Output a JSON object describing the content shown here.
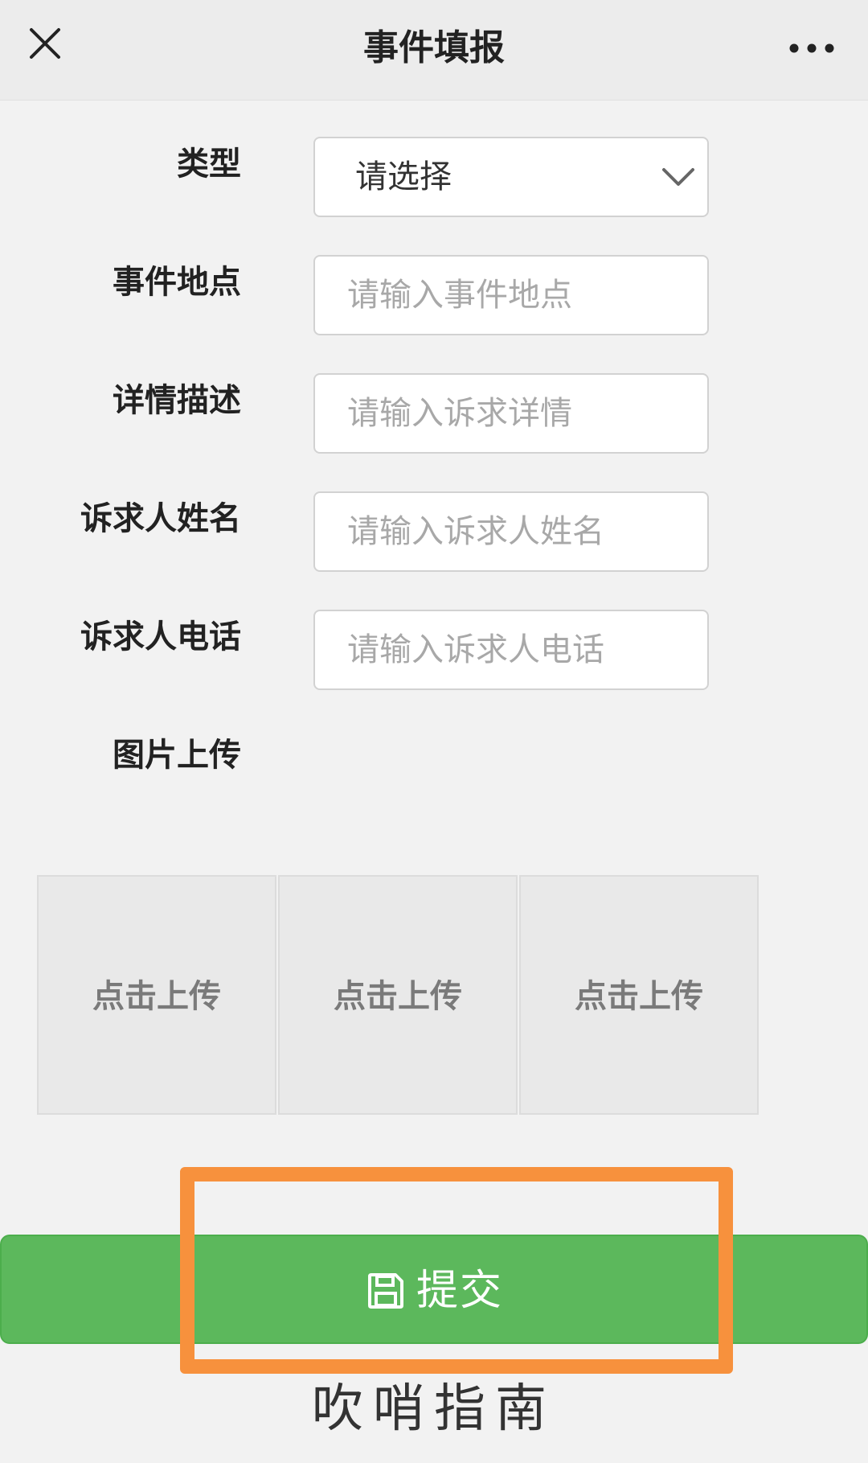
{
  "header": {
    "title": "事件填报",
    "close_icon": "close-icon",
    "more_icon": "more-dots-icon"
  },
  "form": {
    "type": {
      "label": "类型",
      "value": "请选择",
      "icon": "chevron-down-icon"
    },
    "location": {
      "label": "事件地点",
      "placeholder": "请输入事件地点"
    },
    "description": {
      "label": "详情描述",
      "placeholder": "请输入诉求详情"
    },
    "name": {
      "label": "诉求人姓名",
      "placeholder": "请输入诉求人姓名"
    },
    "phone": {
      "label": "诉求人电话",
      "placeholder": "请输入诉求人电话"
    },
    "images": {
      "label": "图片上传",
      "slots": [
        "点击上传",
        "点击上传",
        "点击上传"
      ]
    }
  },
  "submit": {
    "label": "提交",
    "icon": "save-icon",
    "color": "#5cb85c"
  },
  "highlight": {
    "color": "#f7913d"
  },
  "footer": {
    "text": "吹哨指南"
  }
}
